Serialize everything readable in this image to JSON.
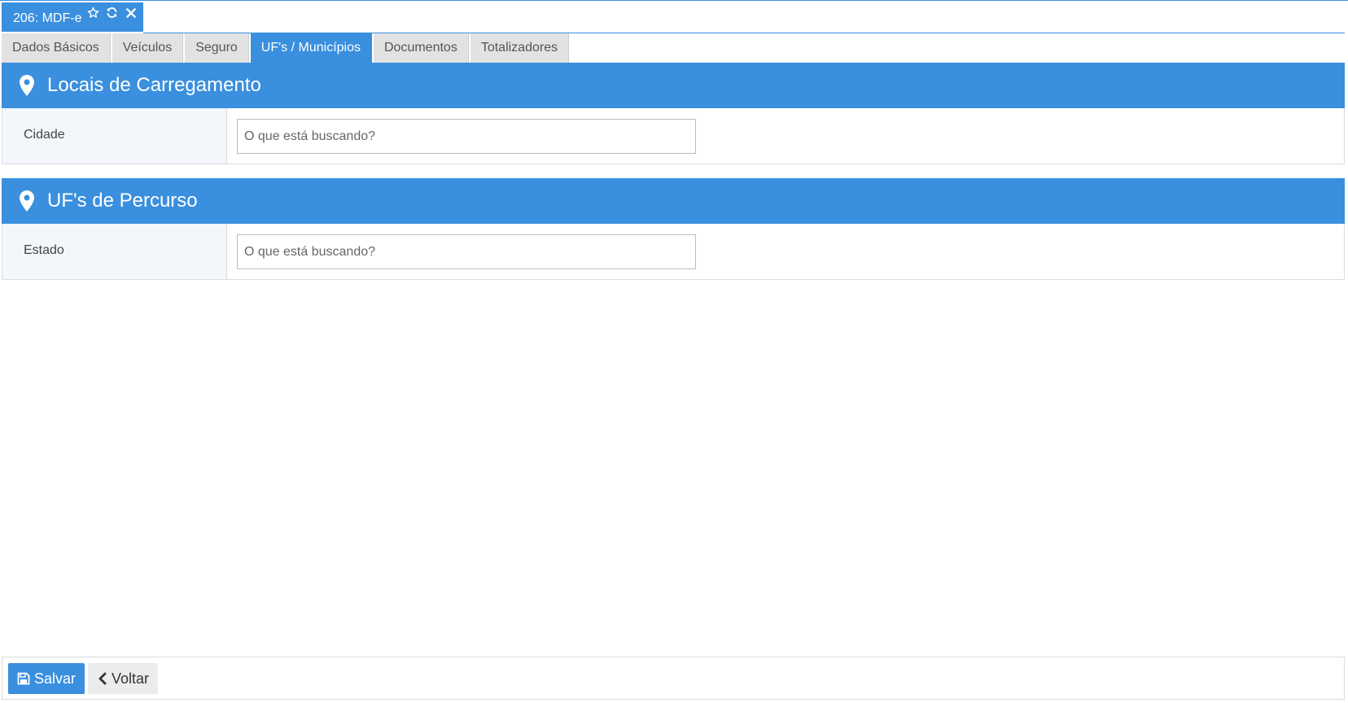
{
  "window_tab": {
    "title": "206: MDF-e",
    "icons": [
      "star-icon",
      "refresh-icon",
      "close-icon"
    ]
  },
  "tabs": [
    {
      "label": "Dados Básicos",
      "active": false
    },
    {
      "label": "Veículos",
      "active": false
    },
    {
      "label": "Seguro",
      "active": false
    },
    {
      "label": "UF's / Municípios",
      "active": true
    },
    {
      "label": "Documentos",
      "active": false
    },
    {
      "label": "Totalizadores",
      "active": false
    }
  ],
  "sections": {
    "loading": {
      "icon": "map-marker-icon",
      "title": "Locais de Carregamento",
      "field_label": "Cidade",
      "placeholder": "O que está buscando?",
      "value": ""
    },
    "route": {
      "icon": "map-marker-icon",
      "title": "UF's de Percurso",
      "field_label": "Estado",
      "placeholder": "O que está buscando?",
      "value": ""
    }
  },
  "footer": {
    "save_label": "Salvar",
    "save_icon": "save-icon",
    "back_label": "Voltar",
    "back_icon": "chevron-left-icon"
  },
  "colors": {
    "accent": "#3a8fde",
    "tab_inactive": "#e2e2e2",
    "label_bg": "#f3f6fb"
  }
}
